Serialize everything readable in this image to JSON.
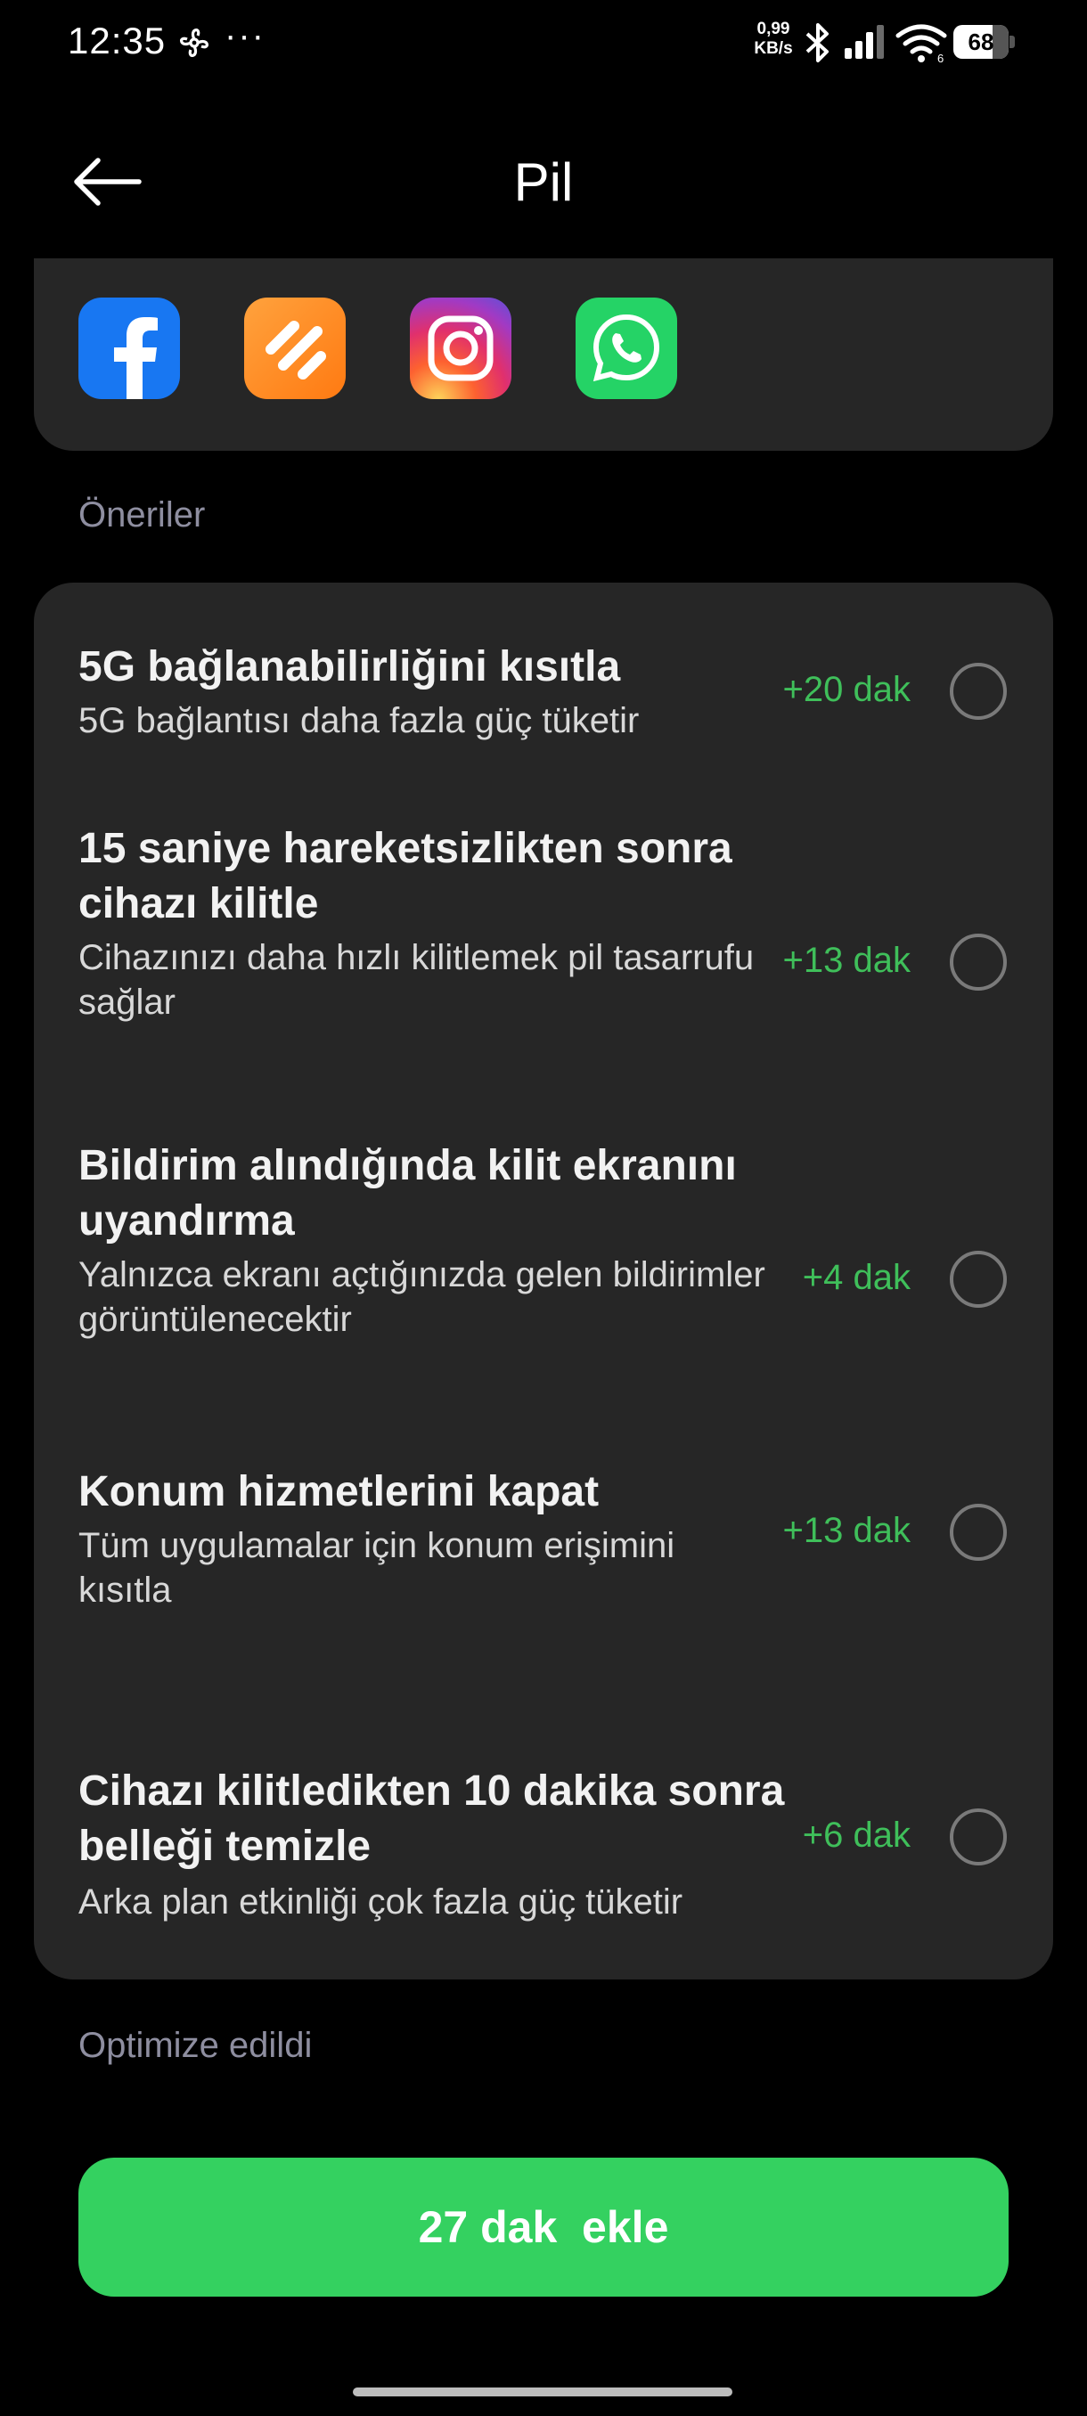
{
  "status_bar": {
    "time": "12:35",
    "overflow": "···",
    "net_speed_value": "0,99",
    "net_speed_unit": "KB/s",
    "battery_level": "68",
    "icons": [
      "fan-icon",
      "bluetooth-icon",
      "cell-signal-icon",
      "wifi-icon",
      "battery-icon"
    ]
  },
  "header": {
    "title": "Pil",
    "back_icon": "back-arrow-icon"
  },
  "apps": [
    {
      "name": "Facebook",
      "icon": "facebook-icon",
      "color": "#1877F2"
    },
    {
      "name": "Hepsiburada",
      "icon": "orange-app-icon",
      "color": "#FF8A1E"
    },
    {
      "name": "Instagram",
      "icon": "instagram-icon",
      "color": "#E1306C"
    },
    {
      "name": "WhatsApp",
      "icon": "whatsapp-icon",
      "color": "#25D366"
    }
  ],
  "suggestions": {
    "label": "Öneriler",
    "items": [
      {
        "title": "5G bağlanabilirliğini kısıtla",
        "description": "5G bağlantısı daha fazla güç tüketir",
        "gain": "+20 dak",
        "selected": false
      },
      {
        "title": "15 saniye hareketsizlikten sonra cihazı kilitle",
        "description": "Cihazınızı daha hızlı kilitlemek pil tasarrufu sağlar",
        "gain": "+13 dak",
        "selected": false
      },
      {
        "title": "Bildirim alındığında kilit ekranını uyandırma",
        "description": "Yalnızca ekranı açtığınızda gelen bildirimler görüntülenecektir",
        "gain": "+4 dak",
        "selected": false
      },
      {
        "title": "Konum hizmetlerini kapat",
        "description": "Tüm uygulamalar için konum erişimini kısıtla",
        "gain": "+13 dak",
        "selected": false
      },
      {
        "title": "Cihazı kilitledikten 10 dakika sonra belleği temizle",
        "description": "Arka plan etkinliği çok fazla güç tüketir",
        "gain": "+6 dak",
        "selected": false
      }
    ]
  },
  "optimized": {
    "label": "Optimize edildi"
  },
  "action_button": {
    "label": "27 dak  ekle"
  },
  "colors": {
    "accent_green": "#34D160",
    "gain_green": "#3FBF5A",
    "card_bg": "#262626",
    "section_label": "#8E8EA0"
  }
}
